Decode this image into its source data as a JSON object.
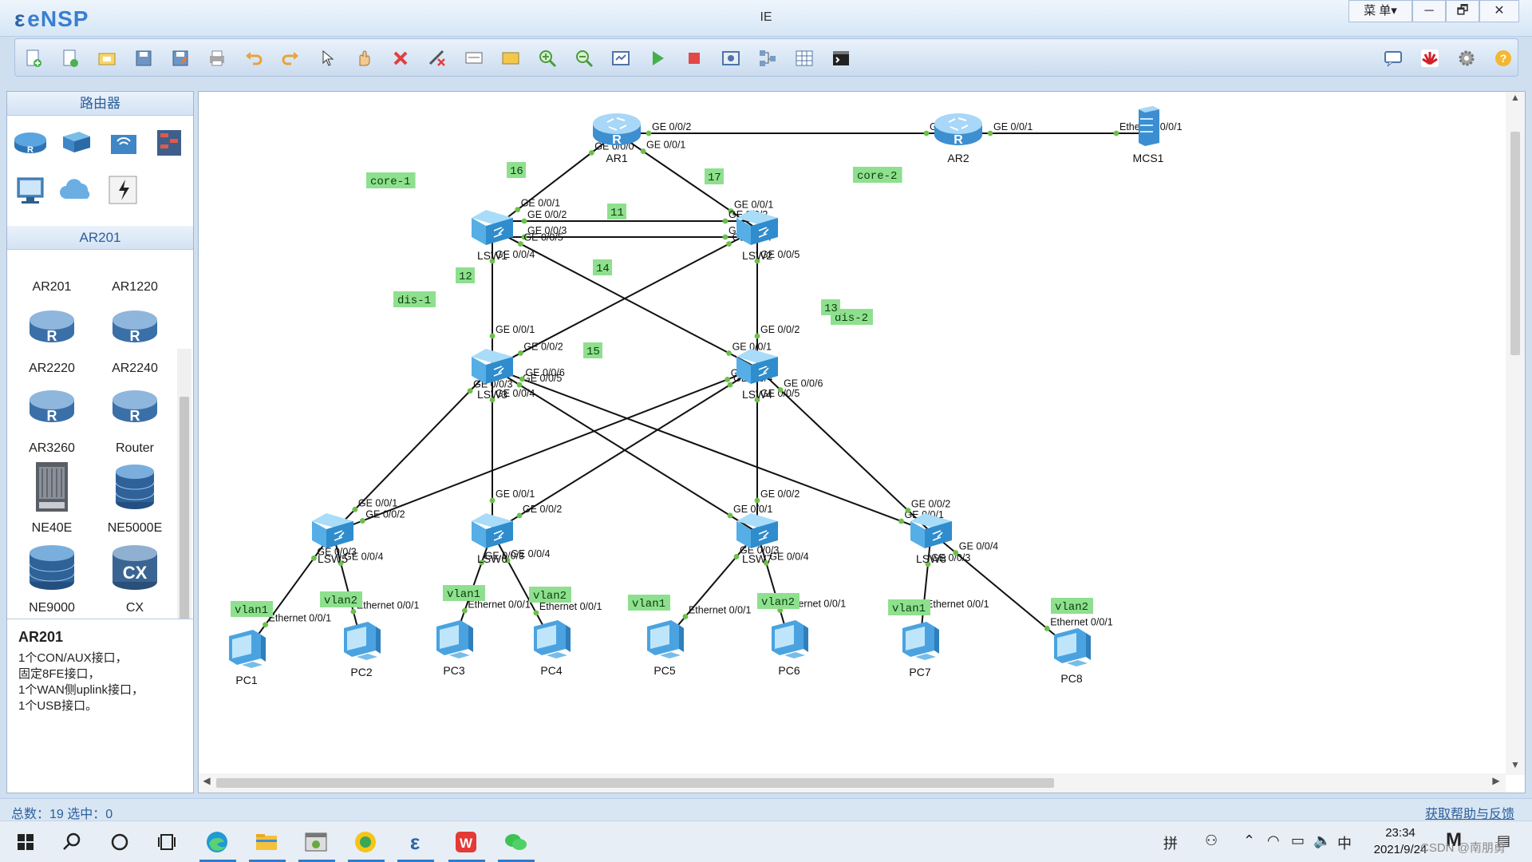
{
  "app": {
    "name": "eNSP",
    "window_title": "IE",
    "menu_label": "菜 单▾",
    "min": "─",
    "max": "🗗",
    "close": "✕"
  },
  "toolbar": {
    "icons": [
      "new-topology",
      "new-lab",
      "open",
      "save",
      "save-as",
      "print",
      "undo",
      "redo",
      "select",
      "pan",
      "delete",
      "delete-link",
      "text-note",
      "rectangle",
      "zoom-in",
      "zoom-out",
      "fit",
      "start-device",
      "stop-device",
      "capture",
      "topology",
      "grid",
      "console"
    ]
  },
  "left": {
    "router_header": "路由器",
    "model_header": "AR201",
    "devices": [
      {
        "name": "AR201"
      },
      {
        "name": "AR1220"
      },
      {
        "name": "AR2220"
      },
      {
        "name": "AR2240"
      },
      {
        "name": "AR3260"
      },
      {
        "name": "Router"
      },
      {
        "name": "NE40E"
      },
      {
        "name": "NE5000E"
      },
      {
        "name": "NE9000"
      },
      {
        "name": "CX"
      }
    ],
    "info": {
      "title": "AR201",
      "lines": [
        "1个CON/AUX接口，",
        "固定8FE接口，",
        "1个WAN侧uplink接口，",
        "1个USB接口。"
      ]
    }
  },
  "topology": {
    "nodes": [
      {
        "id": "AR1",
        "label": "AR1",
        "type": "router"
      },
      {
        "id": "AR2",
        "label": "AR2",
        "type": "router"
      },
      {
        "id": "MCS1",
        "label": "MCS1",
        "type": "server"
      },
      {
        "id": "LSW1",
        "label": "LSW1",
        "type": "switch"
      },
      {
        "id": "LSW2",
        "label": "LSW2",
        "type": "switch"
      },
      {
        "id": "LSW3",
        "label": "LSW3",
        "type": "switch"
      },
      {
        "id": "LSW4",
        "label": "LSW4",
        "type": "switch"
      },
      {
        "id": "LSW5",
        "label": "LSW5",
        "type": "switch"
      },
      {
        "id": "LSW6",
        "label": "LSW6",
        "type": "switch"
      },
      {
        "id": "LSW7",
        "label": "LSW7",
        "type": "switch"
      },
      {
        "id": "LSW8",
        "label": "LSW8",
        "type": "switch"
      },
      {
        "id": "PC1",
        "label": "PC1",
        "type": "pc"
      },
      {
        "id": "PC2",
        "label": "PC2",
        "type": "pc"
      },
      {
        "id": "PC3",
        "label": "PC3",
        "type": "pc"
      },
      {
        "id": "PC4",
        "label": "PC4",
        "type": "pc"
      },
      {
        "id": "PC5",
        "label": "PC5",
        "type": "pc"
      },
      {
        "id": "PC6",
        "label": "PC6",
        "type": "pc"
      },
      {
        "id": "PC7",
        "label": "PC7",
        "type": "pc"
      },
      {
        "id": "PC8",
        "label": "PC8",
        "type": "pc"
      }
    ],
    "links": [
      {
        "a": "AR1",
        "b": "AR2",
        "pa": "GE 0/0/2",
        "pb": "GE 0/0/0"
      },
      {
        "a": "AR2",
        "b": "MCS1",
        "pa": "GE 0/0/1",
        "pb": "Ethernet 0/0/1"
      },
      {
        "a": "AR1",
        "b": "LSW1",
        "pa": "GE 0/0/0",
        "pb": "GE 0/0/1"
      },
      {
        "a": "AR1",
        "b": "LSW2",
        "pa": "GE 0/0/1",
        "pb": "GE 0/0/1"
      },
      {
        "a": "LSW1",
        "b": "LSW2",
        "pa": "GE 0/0/2",
        "pb": "GE 0/0/2"
      },
      {
        "a": "LSW1",
        "b": "LSW2",
        "pa": "GE 0/0/3",
        "pb": "GE 0/0/3"
      },
      {
        "a": "LSW1",
        "b": "LSW3",
        "pa": "GE 0/0/4",
        "pb": "GE 0/0/1"
      },
      {
        "a": "LSW1",
        "b": "LSW4",
        "pa": "GE 0/0/5",
        "pb": "GE 0/0/1"
      },
      {
        "a": "LSW2",
        "b": "LSW3",
        "pa": "GE 0/0/4",
        "pb": "GE 0/0/2"
      },
      {
        "a": "LSW2",
        "b": "LSW4",
        "pa": "GE 0/0/5",
        "pb": "GE 0/0/2"
      },
      {
        "a": "LSW3",
        "b": "LSW5",
        "pa": "GE 0/0/3",
        "pb": "GE 0/0/1"
      },
      {
        "a": "LSW3",
        "b": "LSW6",
        "pa": "GE 0/0/4",
        "pb": "GE 0/0/1"
      },
      {
        "a": "LSW3",
        "b": "LSW7",
        "pa": "GE 0/0/5",
        "pb": "GE 0/0/1"
      },
      {
        "a": "LSW3",
        "b": "LSW8",
        "pa": "GE 0/0/6",
        "pb": "GE 0/0/1"
      },
      {
        "a": "LSW4",
        "b": "LSW5",
        "pa": "GE 0/0/3",
        "pb": "GE 0/0/2"
      },
      {
        "a": "LSW4",
        "b": "LSW6",
        "pa": "GE 0/0/4",
        "pb": "GE 0/0/2"
      },
      {
        "a": "LSW4",
        "b": "LSW7",
        "pa": "GE 0/0/5",
        "pb": "GE 0/0/2"
      },
      {
        "a": "LSW4",
        "b": "LSW8",
        "pa": "GE 0/0/6",
        "pb": "GE 0/0/2"
      },
      {
        "a": "LSW5",
        "b": "PC1",
        "pa": "GE 0/0/3",
        "pb": "Ethernet 0/0/1"
      },
      {
        "a": "LSW5",
        "b": "PC2",
        "pa": "GE 0/0/4",
        "pb": "Ethernet 0/0/1"
      },
      {
        "a": "LSW6",
        "b": "PC3",
        "pa": "GE 0/0/3",
        "pb": "Ethernet 0/0/1"
      },
      {
        "a": "LSW6",
        "b": "PC4",
        "pa": "GE 0/0/4",
        "pb": "Ethernet 0/0/1"
      },
      {
        "a": "LSW7",
        "b": "PC5",
        "pa": "GE 0/0/3",
        "pb": "Ethernet 0/0/1"
      },
      {
        "a": "LSW7",
        "b": "PC6",
        "pa": "GE 0/0/4",
        "pb": "Ethernet 0/0/1"
      },
      {
        "a": "LSW8",
        "b": "PC7",
        "pa": "GE 0/0/3",
        "pb": "Ethernet 0/0/1"
      },
      {
        "a": "LSW8",
        "b": "PC8",
        "pa": "GE 0/0/4",
        "pb": "Ethernet 0/0/1"
      }
    ],
    "tags": [
      "core-1",
      "core-2",
      "dis-1",
      "dis-2",
      "vlan1",
      "vlan2",
      "vlan1",
      "vlan2",
      "vlan1",
      "vlan2",
      "vlan1",
      "vlan2"
    ],
    "link_numbers": [
      "16",
      "17",
      "11",
      "12",
      "14",
      "13",
      "15"
    ]
  },
  "status": {
    "text": "总数：19 选中：0",
    "help": "获取帮助与反馈"
  },
  "taskbar": {
    "time": "23:34",
    "date": "2021/9/24",
    "ime": "中",
    "ime_mode": "拼",
    "watermark": "CSDN @南朋勇"
  },
  "colors": {
    "accent": "#3a7ed0",
    "tag_bg": "#8ee08e",
    "port_dot": "#6cc04a"
  }
}
